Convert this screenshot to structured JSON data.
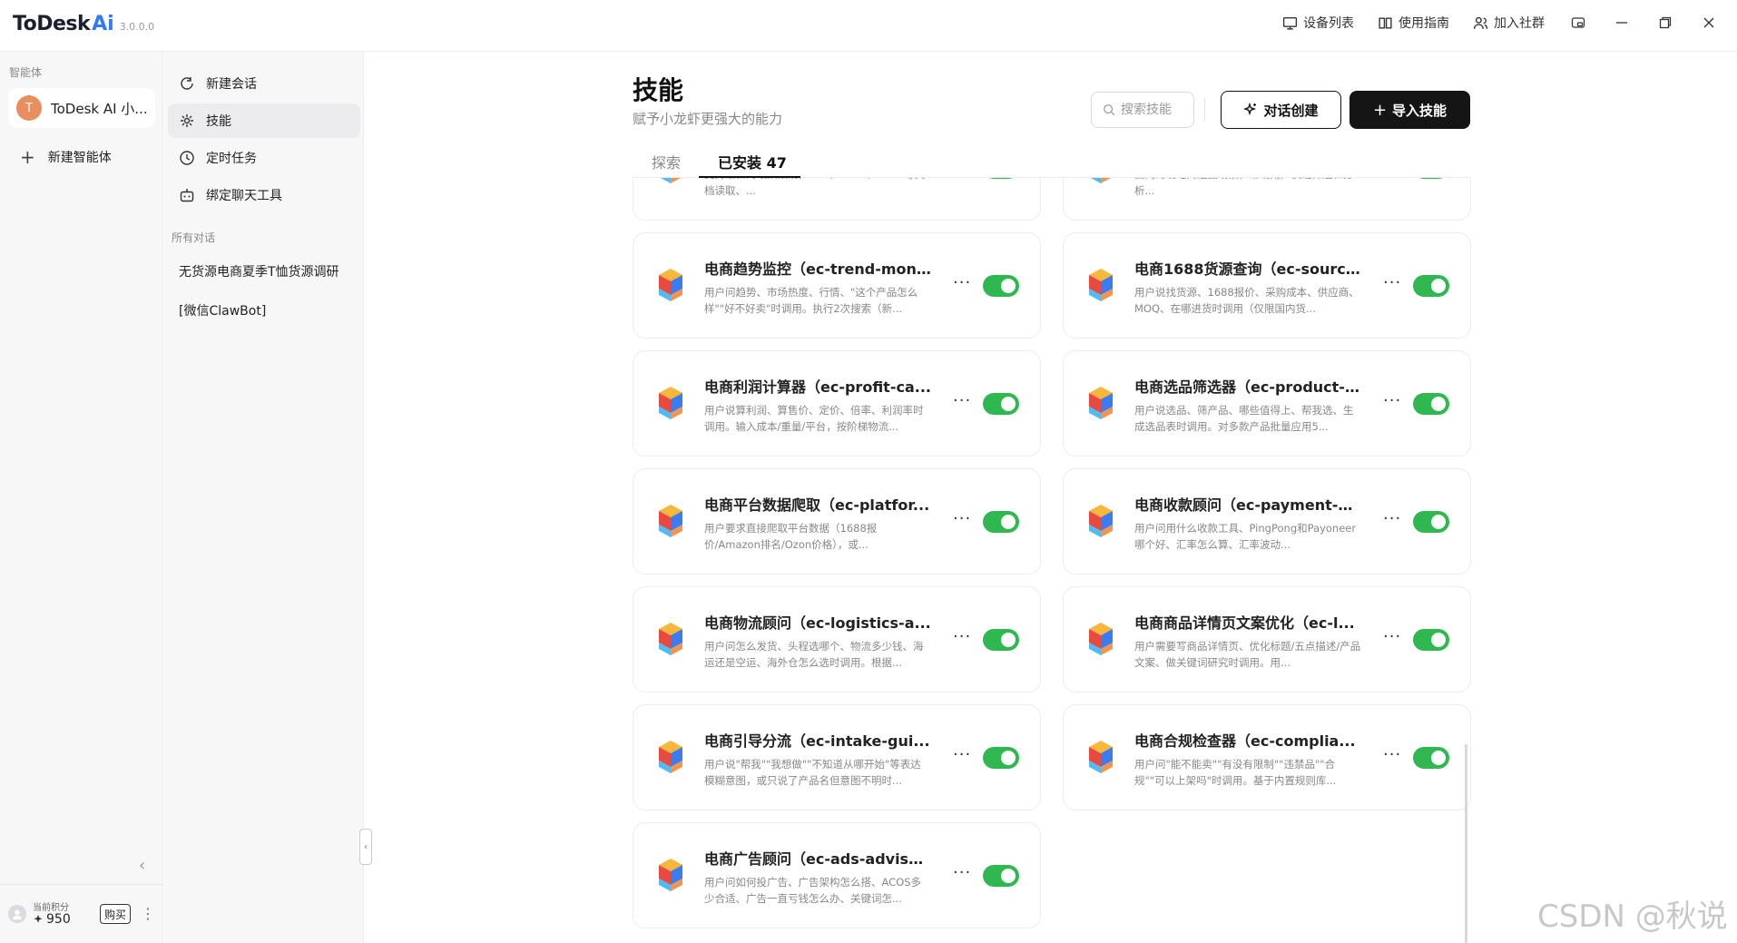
{
  "app": {
    "name": "ToDesk",
    "ai": "Ai",
    "version": "3.0.0.0"
  },
  "titlebar": {
    "device_list": "设备列表",
    "guide": "使用指南",
    "join_community": "加入社群"
  },
  "sidebar1": {
    "label": "智能体",
    "agent": {
      "avatar": "T",
      "name": "ToDesk AI 小..."
    },
    "new_agent": "新建智能体",
    "credits": {
      "label": "当前积分",
      "value": "950",
      "buy": "购买"
    }
  },
  "sidebar2": {
    "nav": [
      {
        "label": "新建会话",
        "icon": "chat-plus-icon"
      },
      {
        "label": "技能",
        "icon": "skill-icon"
      },
      {
        "label": "定时任务",
        "icon": "clock-icon"
      },
      {
        "label": "绑定聊天工具",
        "icon": "robot-icon"
      }
    ],
    "conversations_label": "所有对话",
    "conversations": [
      "无货源电商夏季T恤货源调研",
      "[微信ClawBot]"
    ]
  },
  "main": {
    "title": "技能",
    "subtitle": "赋予小龙虾更强大的能力",
    "search_placeholder": "搜索技能",
    "btn_chat_create": "对话创建",
    "btn_import": "导入技能",
    "tabs": [
      {
        "label": "探索"
      },
      {
        "label": "已安装 47"
      }
    ],
    "cards": [
      {
        "title": "",
        "desc": "支持最新的政策法规，PDF、Word、Excel等文档读取、..."
      },
      {
        "title": "",
        "desc": "面向跨境电商选品场景，帮助用户快速筛选和分析..."
      },
      {
        "title": "电商趋势监控（ec-trend-mon...",
        "desc": "用户问趋势、市场热度、行情、\"这个产品怎么样\"\"好不好卖\"时调用。执行2次搜索（新..."
      },
      {
        "title": "电商1688货源查询（ec-sourci...",
        "desc": "用户说找货源、1688报价、采购成本、供应商、MOQ、在哪进货时调用（仅限国内货..."
      },
      {
        "title": "电商利润计算器（ec-profit-ca...",
        "desc": "用户说算利润、算售价、定价、倍率、利润率时调用。输入成本/重量/平台，按阶梯物流..."
      },
      {
        "title": "电商选品筛选器（ec-product-...",
        "desc": "用户说选品、筛产品、哪些值得上、帮我选、生成选品表时调用。对多款产品批量应用5..."
      },
      {
        "title": "电商平台数据爬取（ec-platfor...",
        "desc": "用户要求直接爬取平台数据（1688报价/Amazon排名/Ozon价格），或..."
      },
      {
        "title": "电商收款顾问（ec-payment-a...",
        "desc": "用户问用什么收款工具、PingPong和Payoneer哪个好、汇率怎么算、汇率波动..."
      },
      {
        "title": "电商物流顾问（ec-logistics-a...",
        "desc": "用户问怎么发货、头程选哪个、物流多少钱、海运还是空运、海外仓怎么选时调用。根据..."
      },
      {
        "title": "电商商品详情页文案优化（ec-l...",
        "desc": "用户需要写商品详情页、优化标题/五点描述/产品文案、做关键词研究时调用。用..."
      },
      {
        "title": "电商引导分流（ec-intake-gui...",
        "desc": "用户说\"帮我\"\"我想做\"\"不知道从哪开始\"等表达模糊意图，或只说了产品名但意图不明时..."
      },
      {
        "title": "电商合规检查器（ec-complia...",
        "desc": "用户问\"能不能卖\"\"有没有限制\"\"违禁品\"\"合规\"\"可以上架吗\"时调用。基于内置规则库..."
      },
      {
        "title": "电商广告顾问（ec-ads-adviso...",
        "desc": "用户问如何投广告、广告架构怎么搭、ACOS多少合适、广告一直亏钱怎么办、关键词怎..."
      }
    ]
  },
  "watermark": "CSDN @秋说",
  "colors": {
    "toggle_on": "#2fb84f",
    "brand_accent": "#2f7bf5",
    "avatar": "#e98f5d"
  }
}
